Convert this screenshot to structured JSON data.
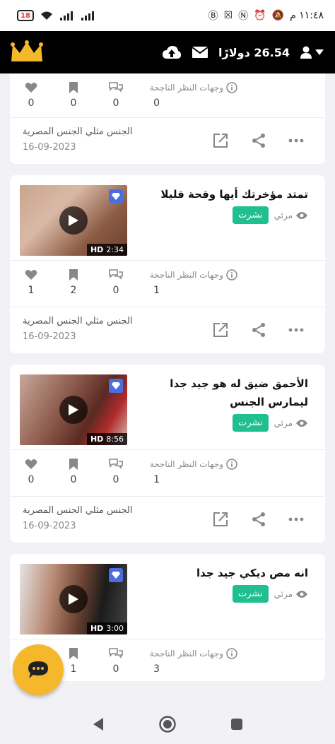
{
  "status_bar": {
    "battery": "18",
    "time": "١١:٤٨ م",
    "icons": [
      "battery-icon",
      "wifi-icon",
      "signal-icon",
      "signal-icon",
      "b-icon",
      "x-icon",
      "n-icon",
      "alarm-icon",
      "mute-icon"
    ]
  },
  "header": {
    "balance": "26.54 دولارًا",
    "icons": [
      "crown-logo-icon",
      "upload-icon",
      "mail-icon",
      "user-icon",
      "dropdown-icon"
    ]
  },
  "labels": {
    "views_label": "وجهات النظر الناجحة",
    "visible_label": "مرئي",
    "published_badge": "نشرت"
  },
  "posts": [
    {
      "title": "",
      "duration": "",
      "quality": "",
      "likes": "0",
      "saves": "0",
      "comments": "0",
      "views": "0",
      "category": "الجنس مثلي الجنس المصرية",
      "date": "16-09-2023"
    },
    {
      "title": "تمتد مؤخرتك أيها وقحة قليلا",
      "duration": "2:34",
      "quality": "HD",
      "likes": "1",
      "saves": "2",
      "comments": "0",
      "views": "1",
      "category": "الجنس مثلي الجنس المصرية",
      "date": "16-09-2023"
    },
    {
      "title": "الأحمق ضيق له هو جيد جدا ليمارس الجنس",
      "duration": "8:56",
      "quality": "HD",
      "likes": "0",
      "saves": "0",
      "comments": "0",
      "views": "1",
      "category": "الجنس مثلي الجنس المصرية",
      "date": "16-09-2023"
    },
    {
      "title": "انه مص ديكي جيد جدا",
      "duration": "3:00",
      "quality": "HD",
      "likes": "",
      "saves": "1",
      "comments": "0",
      "views": "3",
      "category": "",
      "date": ""
    }
  ],
  "colors": {
    "accent_green": "#1fbf8f",
    "header_bg": "#000000",
    "fab_yellow": "#f4b82a",
    "gem_blue": "#4a6ee0"
  }
}
